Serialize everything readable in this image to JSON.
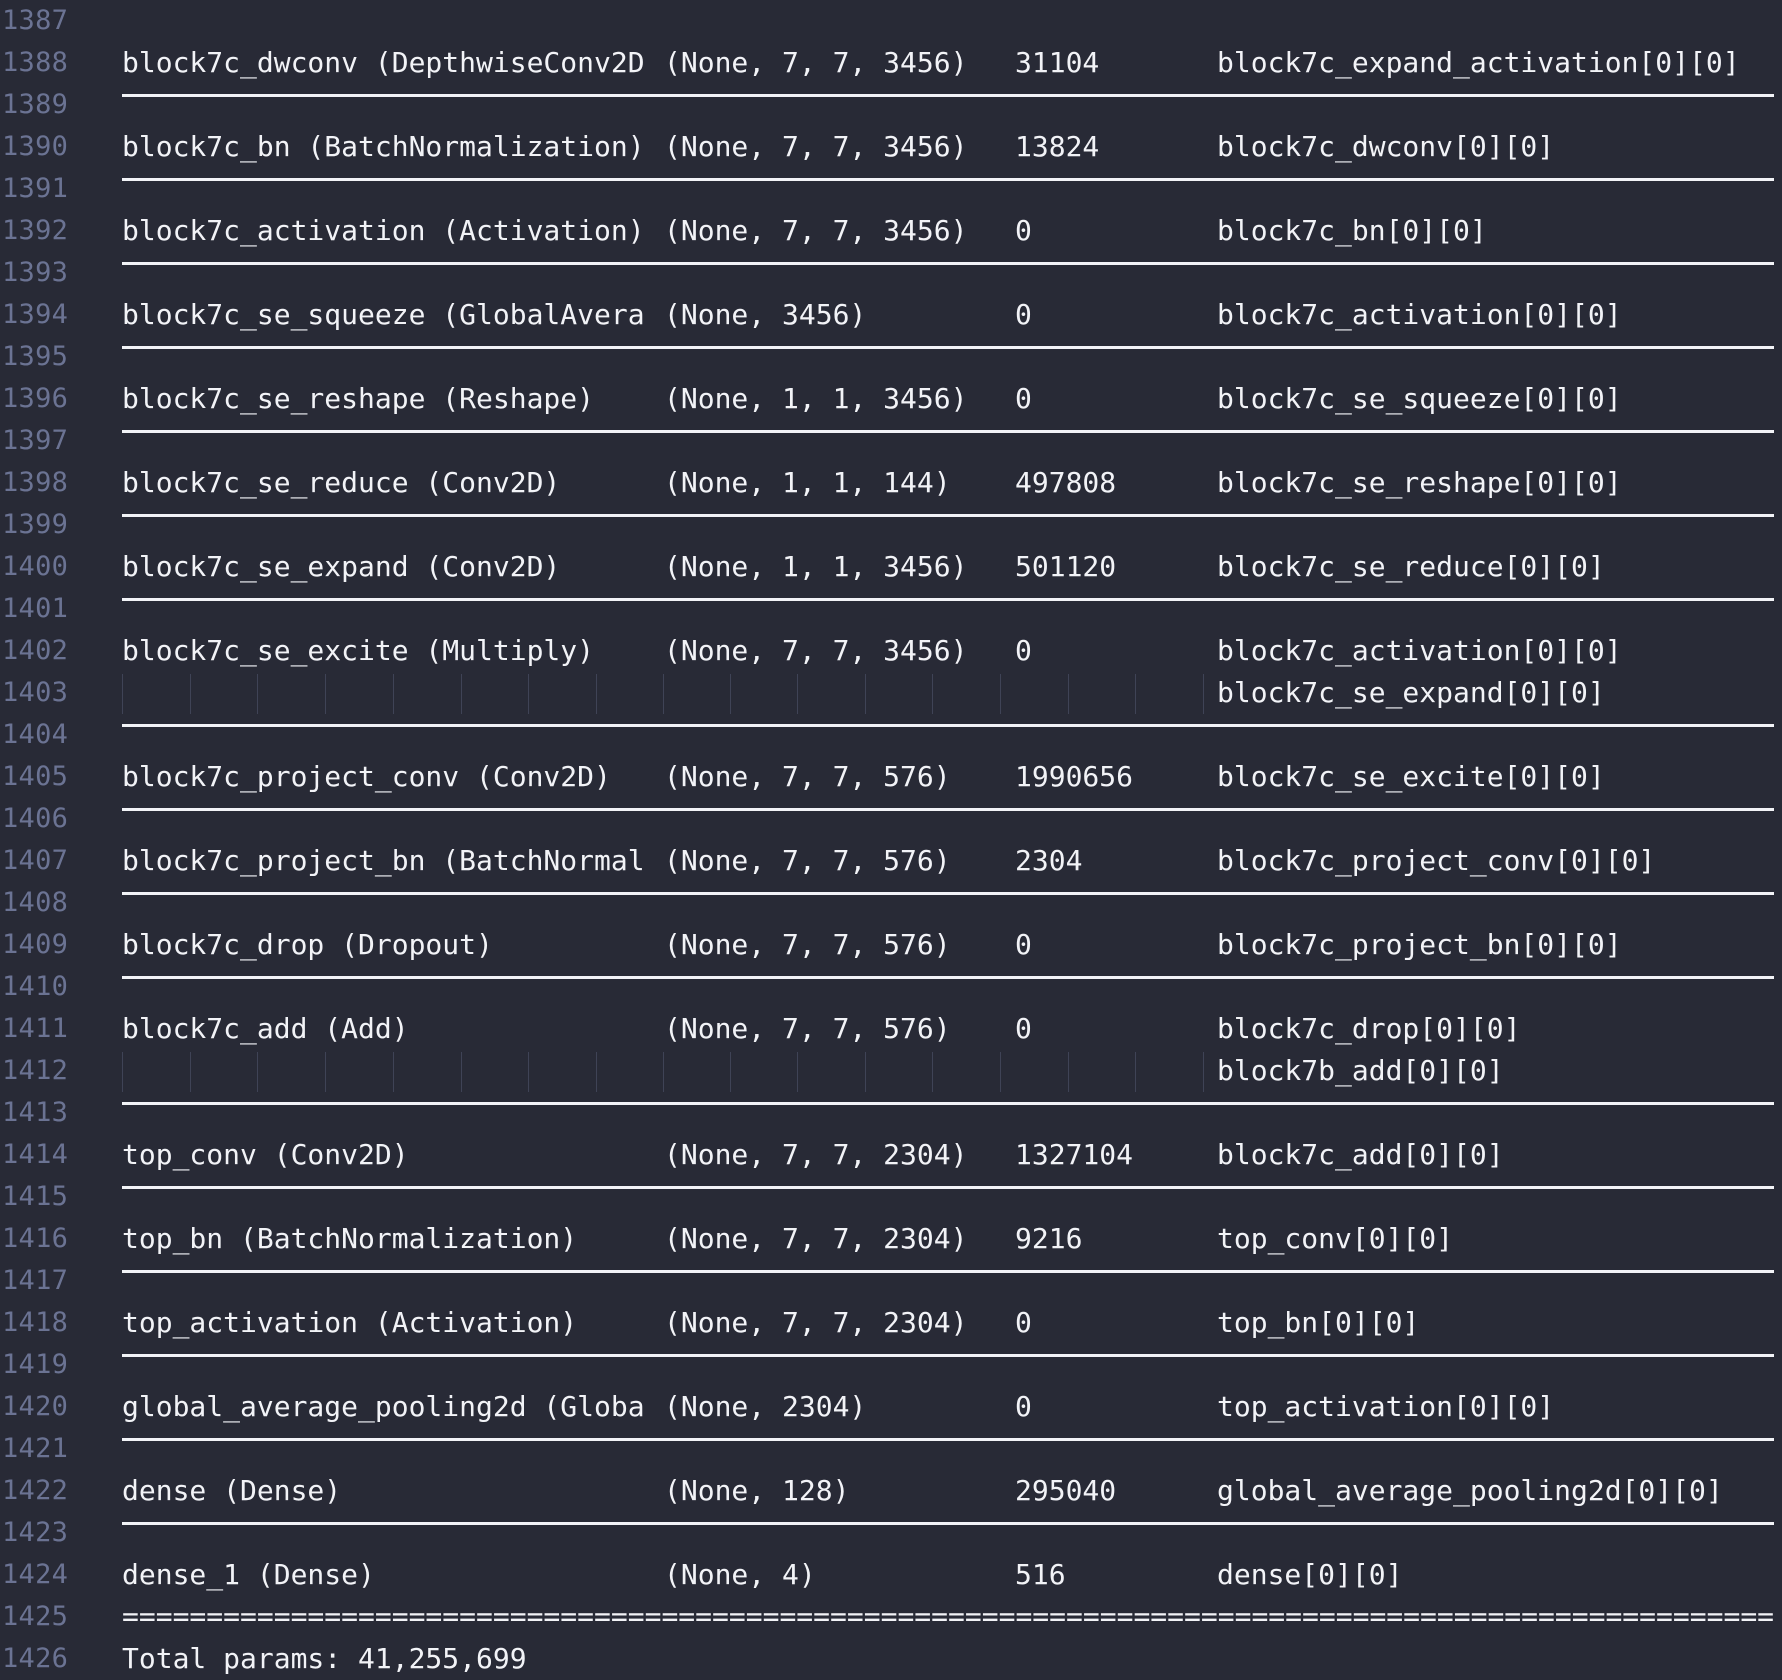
{
  "editor": {
    "theme": {
      "background": "#282a36",
      "text": "#f2f3f7",
      "gutter_text": "#6b7393",
      "indent_guide": "#3f4356"
    },
    "lines": [
      {
        "num": "1387",
        "kind": "blank"
      },
      {
        "num": "1388",
        "kind": "row",
        "layer": "block7c_dwconv (DepthwiseConv2D",
        "shape": "(None, 7, 7, 3456)",
        "params": "31104",
        "connected": "block7c_expand_activation[0][0]"
      },
      {
        "num": "1389",
        "kind": "rule"
      },
      {
        "num": "1390",
        "kind": "row",
        "layer": "block7c_bn (BatchNormalization)",
        "shape": "(None, 7, 7, 3456)",
        "params": "13824",
        "connected": "block7c_dwconv[0][0]"
      },
      {
        "num": "1391",
        "kind": "rule"
      },
      {
        "num": "1392",
        "kind": "row",
        "layer": "block7c_activation (Activation)",
        "shape": "(None, 7, 7, 3456)",
        "params": "0",
        "connected": "block7c_bn[0][0]"
      },
      {
        "num": "1393",
        "kind": "rule"
      },
      {
        "num": "1394",
        "kind": "row",
        "layer": "block7c_se_squeeze (GlobalAvera",
        "shape": "(None, 3456)",
        "params": "0",
        "connected": "block7c_activation[0][0]"
      },
      {
        "num": "1395",
        "kind": "rule"
      },
      {
        "num": "1396",
        "kind": "row",
        "layer": "block7c_se_reshape (Reshape)",
        "shape": "(None, 1, 1, 3456)",
        "params": "0",
        "connected": "block7c_se_squeeze[0][0]"
      },
      {
        "num": "1397",
        "kind": "rule"
      },
      {
        "num": "1398",
        "kind": "row",
        "layer": "block7c_se_reduce (Conv2D)",
        "shape": "(None, 1, 1, 144)",
        "params": "497808",
        "connected": "block7c_se_reshape[0][0]"
      },
      {
        "num": "1399",
        "kind": "rule"
      },
      {
        "num": "1400",
        "kind": "row",
        "layer": "block7c_se_expand (Conv2D)",
        "shape": "(None, 1, 1, 3456)",
        "params": "501120",
        "connected": "block7c_se_reduce[0][0]"
      },
      {
        "num": "1401",
        "kind": "rule"
      },
      {
        "num": "1402",
        "kind": "row",
        "layer": "block7c_se_excite (Multiply)",
        "shape": "(None, 7, 7, 3456)",
        "params": "0",
        "connected": "block7c_activation[0][0]"
      },
      {
        "num": "1403",
        "kind": "cont",
        "connected": "block7c_se_expand[0][0]"
      },
      {
        "num": "1404",
        "kind": "rule"
      },
      {
        "num": "1405",
        "kind": "row",
        "layer": "block7c_project_conv (Conv2D)",
        "shape": "(None, 7, 7, 576)",
        "params": "1990656",
        "connected": "block7c_se_excite[0][0]"
      },
      {
        "num": "1406",
        "kind": "rule"
      },
      {
        "num": "1407",
        "kind": "row",
        "layer": "block7c_project_bn (BatchNormal",
        "shape": "(None, 7, 7, 576)",
        "params": "2304",
        "connected": "block7c_project_conv[0][0]"
      },
      {
        "num": "1408",
        "kind": "rule"
      },
      {
        "num": "1409",
        "kind": "row",
        "layer": "block7c_drop (Dropout)",
        "shape": "(None, 7, 7, 576)",
        "params": "0",
        "connected": "block7c_project_bn[0][0]"
      },
      {
        "num": "1410",
        "kind": "rule"
      },
      {
        "num": "1411",
        "kind": "row",
        "layer": "block7c_add (Add)",
        "shape": "(None, 7, 7, 576)",
        "params": "0",
        "connected": "block7c_drop[0][0]"
      },
      {
        "num": "1412",
        "kind": "cont",
        "connected": "block7b_add[0][0]"
      },
      {
        "num": "1413",
        "kind": "rule"
      },
      {
        "num": "1414",
        "kind": "row",
        "layer": "top_conv (Conv2D)",
        "shape": "(None, 7, 7, 2304)",
        "params": "1327104",
        "connected": "block7c_add[0][0]"
      },
      {
        "num": "1415",
        "kind": "rule"
      },
      {
        "num": "1416",
        "kind": "row",
        "layer": "top_bn (BatchNormalization)",
        "shape": "(None, 7, 7, 2304)",
        "params": "9216",
        "connected": "top_conv[0][0]"
      },
      {
        "num": "1417",
        "kind": "rule"
      },
      {
        "num": "1418",
        "kind": "row",
        "layer": "top_activation (Activation)",
        "shape": "(None, 7, 7, 2304)",
        "params": "0",
        "connected": "top_bn[0][0]"
      },
      {
        "num": "1419",
        "kind": "rule"
      },
      {
        "num": "1420",
        "kind": "row",
        "layer": "global_average_pooling2d (Globa",
        "shape": "(None, 2304)",
        "params": "0",
        "connected": "top_activation[0][0]"
      },
      {
        "num": "1421",
        "kind": "rule"
      },
      {
        "num": "1422",
        "kind": "row",
        "layer": "dense (Dense)",
        "shape": "(None, 128)",
        "params": "295040",
        "connected": "global_average_pooling2d[0][0]"
      },
      {
        "num": "1423",
        "kind": "rule"
      },
      {
        "num": "1424",
        "kind": "row",
        "layer": "dense_1 (Dense)",
        "shape": "(None, 4)",
        "params": "516",
        "connected": "dense[0][0]"
      },
      {
        "num": "1425",
        "kind": "double",
        "text": "===================================================================================================="
      },
      {
        "num": "1426",
        "kind": "text",
        "text": "Total params: 41,255,699"
      }
    ]
  }
}
